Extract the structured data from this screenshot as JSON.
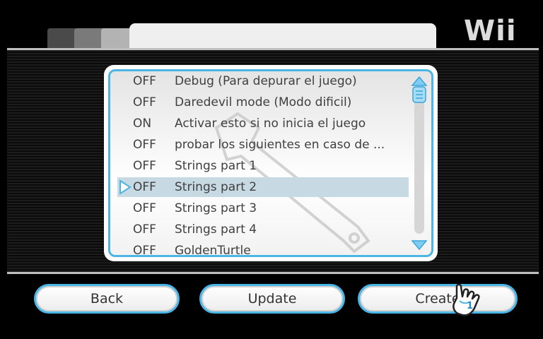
{
  "header": {
    "logo_text": "Wii"
  },
  "list": {
    "items": [
      {
        "state": "OFF",
        "label": "Debug (Para depurar el juego)"
      },
      {
        "state": "OFF",
        "label": "Daredevil mode (Modo dificil)"
      },
      {
        "state": "ON",
        "label": "Activar esto si no inicia el juego"
      },
      {
        "state": "OFF",
        "label": "probar los siguientes en caso de ..."
      },
      {
        "state": "OFF",
        "label": "Strings part 1"
      },
      {
        "state": "OFF",
        "label": "Strings part 2"
      },
      {
        "state": "OFF",
        "label": "Strings part 3"
      },
      {
        "state": "OFF",
        "label": "Strings part 4"
      },
      {
        "state": "OFF",
        "label": "GoldenTurtle"
      }
    ],
    "selected_index": 5
  },
  "buttons": {
    "back": "Back",
    "update": "Update",
    "create": "Create"
  },
  "cursor": {
    "player_number": "1"
  },
  "colors": {
    "accent": "#4bb5e6",
    "selection": "#c7d9e2",
    "background": "#000000"
  },
  "icons": {
    "background_watermark": "wrench-icon",
    "selection_marker": "triangle-right-icon",
    "scroll_up": "scroll-up-arrow-icon",
    "scroll_down": "scroll-down-arrow-icon",
    "pointer": "wii-hand-cursor-icon"
  }
}
